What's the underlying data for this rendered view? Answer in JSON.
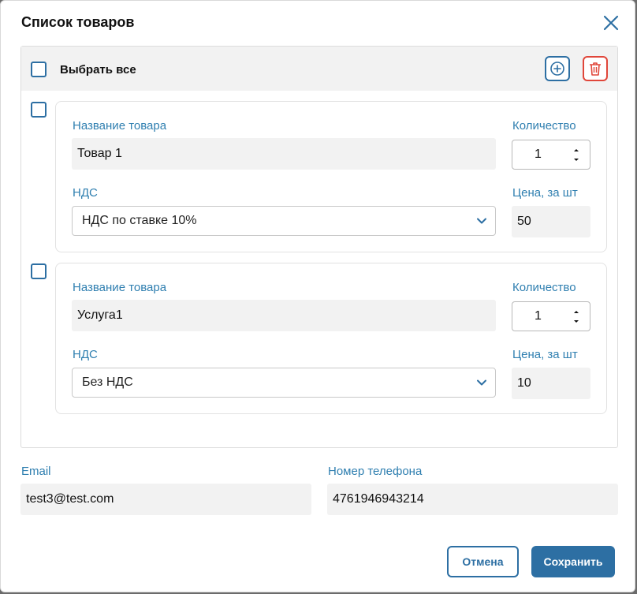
{
  "dialog": {
    "title": "Список товаров",
    "select_all_label": "Выбрать все"
  },
  "labels": {
    "name": "Название товара",
    "quantity": "Количество",
    "vat": "НДС",
    "price": "Цена, за шт"
  },
  "items": [
    {
      "name": "Товар 1",
      "quantity": "1",
      "vat": "НДС по ставке 10%",
      "price": "50"
    },
    {
      "name": "Услуга1",
      "quantity": "1",
      "vat": "Без НДС",
      "price": "10"
    }
  ],
  "contact": {
    "email_label": "Email",
    "email_value": "test3@test.com",
    "phone_label": "Номер телефона",
    "phone_value": "4761946943214"
  },
  "actions": {
    "cancel": "Отмена",
    "save": "Сохранить"
  },
  "colors": {
    "accent": "#2d6fa3",
    "danger": "#e0463a",
    "label": "#2f7fb0"
  },
  "icons": [
    "close-icon",
    "add-circle-icon",
    "trash-icon",
    "chevron-down-icon",
    "stepper-arrows-icon"
  ]
}
